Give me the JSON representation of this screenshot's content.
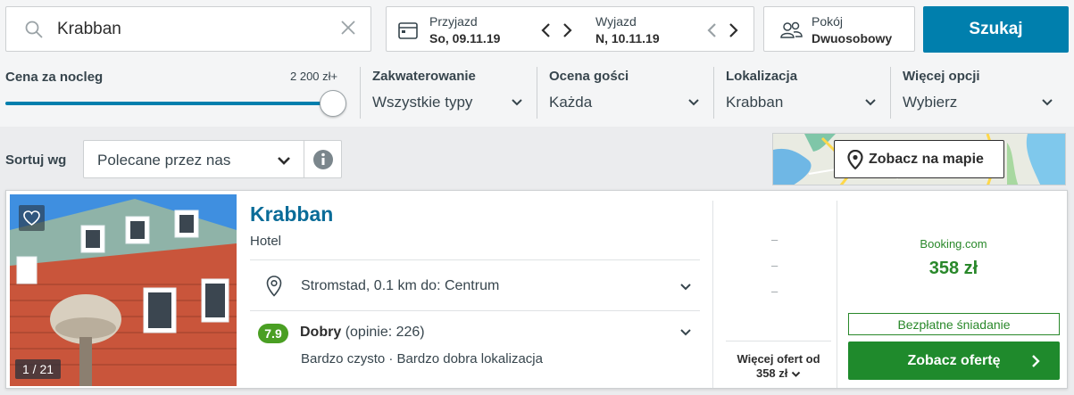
{
  "search": {
    "value": "Krabban",
    "clear_icon": "close-icon",
    "search_icon": "search-icon"
  },
  "dates": {
    "checkin_label": "Przyjazd",
    "checkin_value": "So, 09.11.19",
    "checkout_label": "Wyjazd",
    "checkout_value": "N, 10.11.19"
  },
  "room": {
    "label": "Pokój",
    "value": "Dwuosobowy"
  },
  "search_button": "Szukaj",
  "filters": {
    "price": {
      "label": "Cena za nocleg",
      "max": "2 200 zł+",
      "slider_level_fraction": 1.0
    },
    "accommodation": {
      "label": "Zakwaterowanie",
      "value": "Wszystkie typy"
    },
    "rating": {
      "label": "Ocena gości",
      "value": "Każda"
    },
    "location": {
      "label": "Lokalizacja",
      "value": "Krabban"
    },
    "more": {
      "label": "Więcej opcji",
      "value": "Wybierz"
    }
  },
  "sort": {
    "label": "Sortuj wg",
    "value": "Polecane przez nas"
  },
  "map_button": "Zobacz na mapie",
  "result": {
    "name": "Krabban",
    "type": "Hotel",
    "photo_counter": "1 / 21",
    "location": "Stromstad, 0.1 km do: Centrum",
    "rating_score": "7.9",
    "rating_word": "Dobry",
    "rating_count": "(opinie: 226)",
    "rating_highlights": "Bardzo czysto · Bardzo dobra lokalizacja",
    "other_prices": [
      "–",
      "–",
      "–"
    ],
    "more_offers_line1": "Więcej ofert od",
    "more_offers_line2": "358 zł",
    "provider": "Booking.com",
    "price": "358 zł",
    "perk": "Bezpłatne śniadanie",
    "cta": "Zobacz ofertę"
  },
  "colors": {
    "accent_blue": "#007fad",
    "hotel_name": "#0a6c98",
    "deal_green": "#1f8a2c",
    "rating_green": "#4a9f23"
  }
}
